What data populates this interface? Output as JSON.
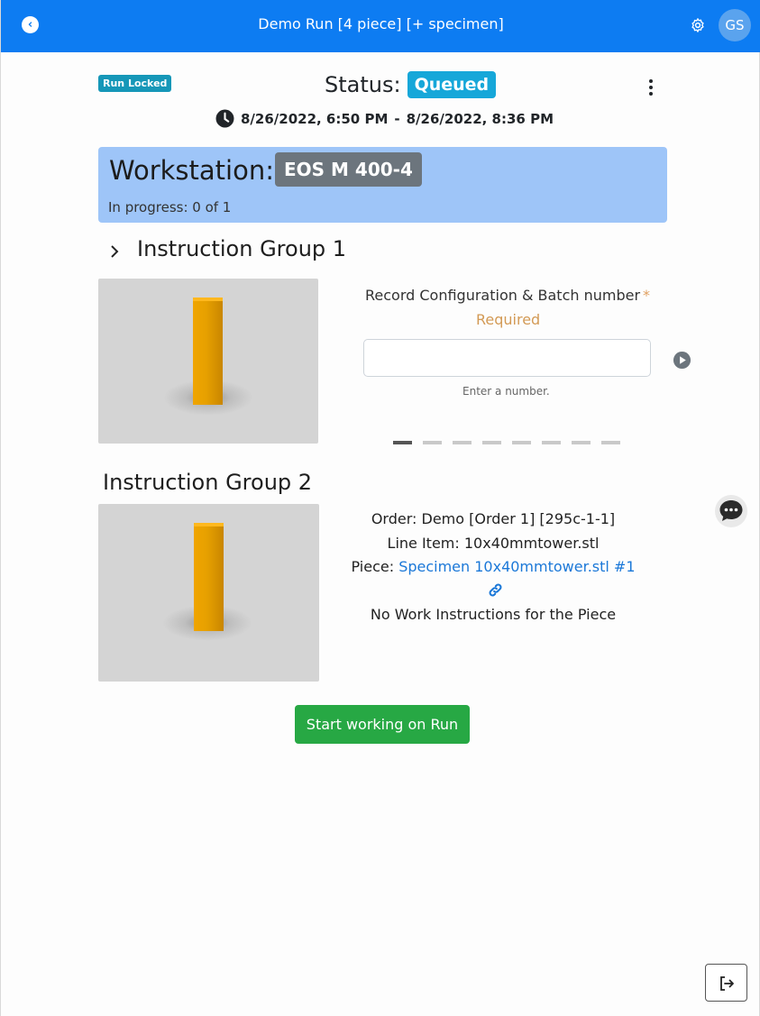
{
  "header": {
    "title": "Demo Run [4 piece] [+ specimen]",
    "avatar_initials": "GS",
    "back_icon": "back-arrow-icon",
    "settings_icon": "gear-icon"
  },
  "run": {
    "lock_badge": "Run Locked",
    "status_label": "Status:",
    "status_value": "Queued",
    "start_time": "8/26/2022, 6:50 PM",
    "separator": "-",
    "end_time": "8/26/2022, 8:36 PM"
  },
  "workstation": {
    "label": "Workstation:",
    "name": "EOS M 400-4",
    "progress": "In progress: 0 of 1"
  },
  "group1": {
    "title": "Instruction Group 1",
    "step_title": "Record Configuration & Batch number",
    "required_star": "*",
    "required_text": "Required",
    "input_value": "",
    "input_hint": "Enter a number.",
    "carousel_count": 8,
    "carousel_active": 1
  },
  "group2": {
    "title": "Instruction Group 2",
    "order": "Order: Demo [Order 1] [295c-1-1]",
    "line_item": "Line Item: 10x40mmtower.stl",
    "piece_prefix": "Piece: ",
    "piece_link": "Specimen 10x40mmtower.stl #1",
    "no_instructions": "No Work Instructions for the Piece"
  },
  "actions": {
    "start_button": "Start working on Run"
  },
  "colors": {
    "header": "#0d7cf2",
    "status_badge": "#16a7d9",
    "lock_badge": "#1697b8",
    "workstation_card": "#9ec5f8",
    "start_button": "#27a844"
  }
}
